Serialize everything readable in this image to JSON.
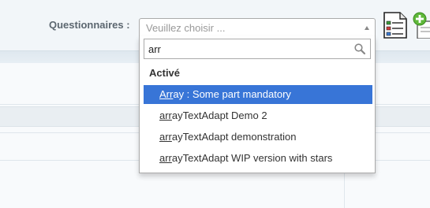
{
  "form": {
    "label": "Questionnaires :",
    "select_placeholder": "Veuillez choisir ..."
  },
  "dropdown": {
    "search_value": "arr",
    "group": "Activé",
    "options": [
      {
        "match": "Arr",
        "rest": "ay : Some part mandatory",
        "highlighted": true
      },
      {
        "match": "arr",
        "rest": "ayTextAdapt Demo 2",
        "highlighted": false
      },
      {
        "match": "arr",
        "rest": "ayTextAdapt demonstration",
        "highlighted": false
      },
      {
        "match": "arr",
        "rest": "ayTextAdapt WIP version with stars",
        "highlighted": false
      }
    ]
  },
  "colors": {
    "highlight": "#3875d7",
    "add_icon": "#5fb83a"
  },
  "icons": [
    "search-icon",
    "checklist-document-icon",
    "add-icon"
  ]
}
